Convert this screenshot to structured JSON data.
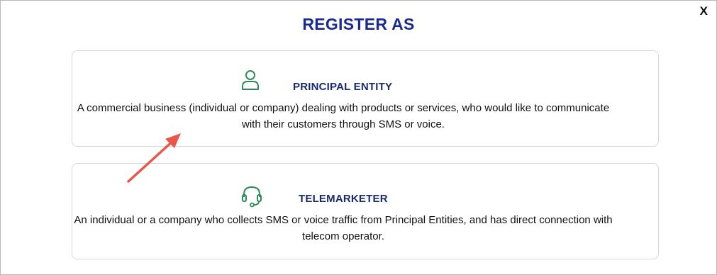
{
  "dialog": {
    "title": "REGISTER AS",
    "close_label": "X"
  },
  "options": [
    {
      "heading": "PRINCIPAL ENTITY",
      "icon": "user-icon",
      "description": "A commercial business (individual or company) dealing with products or services, who would like to communicate with their customers through SMS or voice."
    },
    {
      "heading": "TELEMARKETER",
      "icon": "headset-icon",
      "description": "An individual or a company who collects SMS or voice traffic from Principal Entities, and has direct connection with telecom operator."
    }
  ],
  "colors": {
    "title": "#1a2a8f",
    "heading": "#1a2a6e",
    "icon": "#2e8b57",
    "annotation_arrow": "#e8574a",
    "card_border": "#d7d7d7"
  }
}
